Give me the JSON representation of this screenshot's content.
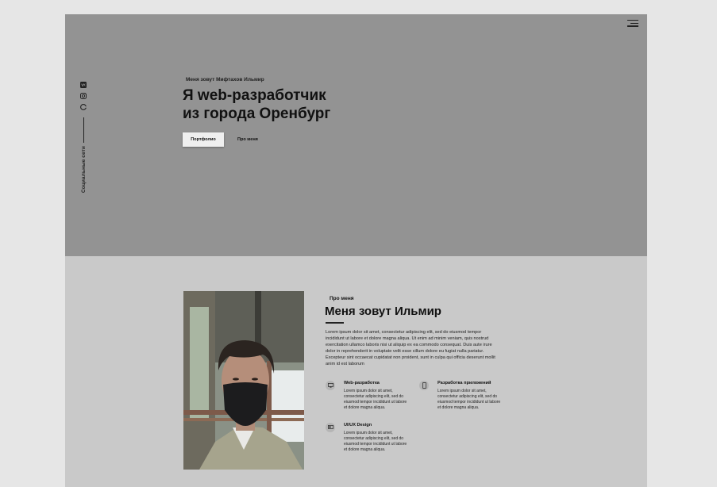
{
  "hero": {
    "intro": "Меня зовут Мифтахов Ильмир",
    "headline_line1": "Я web-разработчик",
    "headline_line2": "из города Оренбург",
    "portfolio_button": "Портфолио",
    "about_link": "Про меня",
    "social_label": "Социальные сети",
    "social_icons": [
      "vk-icon",
      "instagram-icon",
      "github-icon"
    ]
  },
  "about": {
    "tag": "Про меня",
    "title": "Меня зовут Ильмир",
    "text": "Lorem ipsum dolor sit amet, consectetur adipiscing elit, sed do eiusmod tempor incididunt ut labore et dolore magna aliqua. Ut enim ad minim veniam, quis nostrud exercitation ullamco laboris nisi ut aliquip ex ea commodo consequat. Duis aute irure dolor in reprehenderit in voluptate velit esse cillum dolore eu fugiat nulla pariatur. Excepteur sint occaecat cupidatat non proident, sunt in culpa qui officia deserunt mollit anim id est laborum",
    "services": [
      {
        "title": "Web-разработка",
        "text": "Lorem ipsum dolor sit amet, consectetur adipiscing elit, sed do eiusmod tempor incididunt ut labore et dolore magna aliqua."
      },
      {
        "title": "Разработка приложений",
        "text": "Lorem ipsum dolor sit amet, consectetur adipiscing elit, sed do eiusmod tempor incididunt ut labore et dolore magna aliqua."
      },
      {
        "title": "UI/UX Design",
        "text": "Lorem ipsum dolor sit amet, consectetur adipiscing elit, sed do eiusmod tempor incididunt ut labore et dolore magna aliqua."
      }
    ]
  },
  "colors": {
    "hero_bg": "#939393",
    "about_bg": "#c9c9c9",
    "outer_bg": "#e6e6e6",
    "text": "#111111"
  }
}
